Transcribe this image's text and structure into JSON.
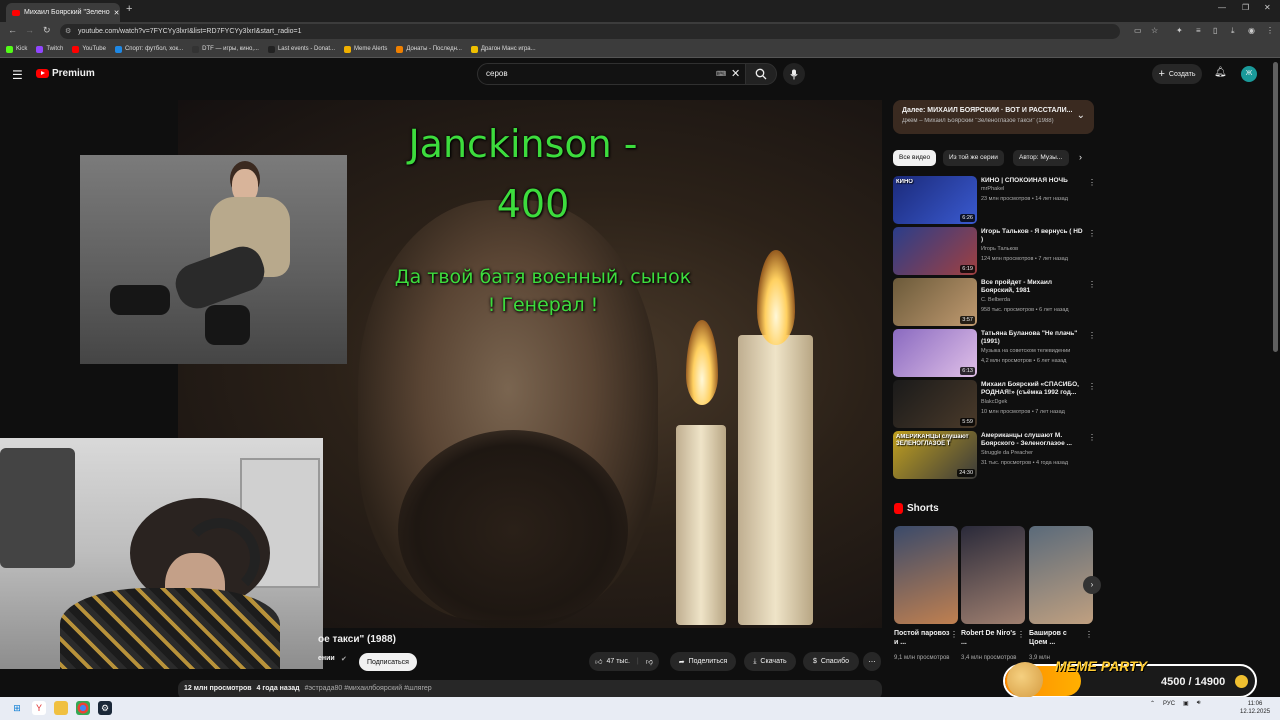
{
  "browser": {
    "tab_title": "Михаил Боярский \"Зелено",
    "url": "youtube.com/watch?v=7FYCYy3lxrI&list=RD7FYCYy3lxrI&start_radio=1",
    "bookmarks": [
      "Kick",
      "Twitch",
      "YouTube",
      "Спорт: футбол, хок...",
      "DTF — игры, кино,...",
      "Last events - Donat...",
      "Meme Alerts",
      "Донаты - Последн...",
      "Драгон Манс игра..."
    ],
    "bookmark_colors": [
      "#53fc18",
      "#9146ff",
      "#ff0000",
      "#1e88e5",
      "#333333",
      "#222222",
      "#f0b000",
      "#f08000",
      "#f0c000"
    ]
  },
  "header": {
    "logo_text": "Premium",
    "search_value": "серов",
    "create_label": "Создать",
    "avatar_letter": "Ж"
  },
  "overlay": {
    "title_line1": "Janckinson -",
    "title_line2": "400",
    "message_line1": "Да твой батя военный, сынок",
    "message_line2": "! Генерал !"
  },
  "video": {
    "title_visible": "ое такси\" (1988)",
    "channel_visible": "ении",
    "subscribe_label": "Подписаться",
    "likes": "47 тыс.",
    "share_label": "Поделиться",
    "download_label": "Скачать",
    "thanks_label": "Спасибо",
    "views": "12 млн просмотров",
    "age": "4 года назад",
    "tags": "#эстрада80 #михаилбоярский #шлягер"
  },
  "playlist": {
    "title": "Далее: МИХАИЛ БОЯРСКИЙ · ВОТ И РАССТАЛИ...",
    "subtitle": "Джем – Михаил Боярский \"Зеленоглазое такси\" (1988)"
  },
  "chips": [
    "Все видео",
    "Из той же серии",
    "Автор: Музы..."
  ],
  "recommendations": [
    {
      "title": "КИНО | СПОКОЙНАЯ НОЧЬ",
      "channel": "mrPhakel",
      "meta": "23 млн просмотров • 14 лет назад",
      "duration": "6:26",
      "thumb_text": "КИНО",
      "colors": [
        "#1b2a7a",
        "#3a5ad0"
      ]
    },
    {
      "title": "Игорь Тальков - Я вернусь ( HD )",
      "channel": "Игорь Тальков",
      "meta": "124 млн просмотров • 7 лет назад",
      "duration": "6:19",
      "thumb_text": "",
      "colors": [
        "#2a3d8a",
        "#a04040"
      ]
    },
    {
      "title": "Все пройдет - Михаил Боярский, 1981",
      "channel": "С. Belberda",
      "meta": "958 тыс. просмотров • 6 лет назад",
      "duration": "3:57",
      "thumb_text": "",
      "colors": [
        "#6b5a3a",
        "#c09a70"
      ]
    },
    {
      "title": "Татьяна Буланова \"Не плачь\" (1991)",
      "channel": "Музыка на советском телевидении",
      "meta": "4,2 млн просмотров • 6 лет назад",
      "duration": "6:13",
      "thumb_text": "",
      "colors": [
        "#8a6ac0",
        "#e0c0e8"
      ]
    },
    {
      "title": "Михаил Боярский «СПАСИБО, РОДНАЯ!» (съёмка 1992 год...",
      "channel": "BlakcDgek",
      "meta": "10 млн просмотров • 7 лет назад",
      "duration": "5:59",
      "thumb_text": "",
      "colors": [
        "#1a1a1a",
        "#4a3a2a"
      ]
    },
    {
      "title": "Американцы слушают М. Боярского - Зеленоглазое ...",
      "channel": "Struggle da Preacher",
      "meta": "31 тыс. просмотров • 4 года назад",
      "duration": "24:30",
      "thumb_text": "АМЕРИКАНЦЫ слушают ЗЕЛЕНОГЛАЗОЕ Т",
      "colors": [
        "#c0a020",
        "#3a3a3a"
      ]
    }
  ],
  "shorts": {
    "header": "Shorts",
    "items": [
      {
        "title": "Постой паровоз и ...",
        "views": "9,1 млн просмотров",
        "colors": [
          "#3a4a6a",
          "#c08050"
        ]
      },
      {
        "title": "Robert De Niro's ...",
        "views": "3,4 млн просмотров",
        "colors": [
          "#2a2a3a",
          "#a08070"
        ]
      },
      {
        "title": "Баширов с Цоем ...",
        "views": "3,9 млн",
        "colors": [
          "#5a6a7a",
          "#c0a080"
        ]
      }
    ]
  },
  "meme_widget": {
    "title": "MEME PARTY",
    "progress": "4500 / 14900"
  },
  "taskbar": {
    "lang": "РУС",
    "time": "11:06",
    "date": "12.12.2025"
  }
}
